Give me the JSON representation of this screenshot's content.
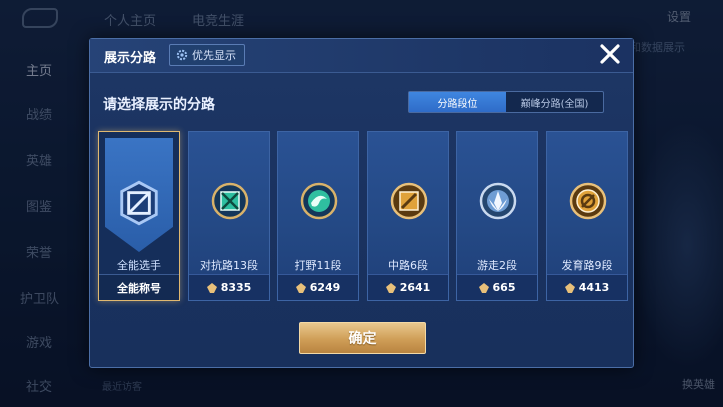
{
  "background": {
    "top_tabs": [
      "个人主页",
      "电竞生涯"
    ],
    "settings_label": "设置",
    "sidebar_items": [
      "主页",
      "战绩",
      "英雄",
      "图鉴",
      "荣誉",
      "护卫队",
      "游戏",
      "社交"
    ],
    "right_label": "和数据展示",
    "recent_label": "最近访客",
    "swap_hero_label": "换英雄"
  },
  "modal": {
    "title": "展示分路",
    "priority_button": "优先显示",
    "subtitle": "请选择展示的分路",
    "tabs": [
      {
        "label": "分路段位",
        "active": true
      },
      {
        "label": "巅峰分路(全国)",
        "active": false
      }
    ],
    "cards": [
      {
        "name": "全能选手",
        "footer": "全能称号",
        "selected": true,
        "icon": "all-role-emblem-icon",
        "color": "#7fb0ff"
      },
      {
        "name": "对抗路13段",
        "value": "8335",
        "selected": false,
        "icon": "clash-lane-emblem-icon",
        "color": "#2fbfa0"
      },
      {
        "name": "打野11段",
        "value": "6249",
        "selected": false,
        "icon": "jungle-emblem-icon",
        "color": "#2fbfa0"
      },
      {
        "name": "中路6段",
        "value": "2641",
        "selected": false,
        "icon": "mid-lane-emblem-icon",
        "color": "#e0a23a"
      },
      {
        "name": "游走2段",
        "value": "665",
        "selected": false,
        "icon": "roam-emblem-icon",
        "color": "#9fc4f0"
      },
      {
        "name": "发育路9段",
        "value": "4413",
        "selected": false,
        "icon": "farm-lane-emblem-icon",
        "color": "#e0a23a"
      }
    ],
    "confirm_label": "确定"
  }
}
